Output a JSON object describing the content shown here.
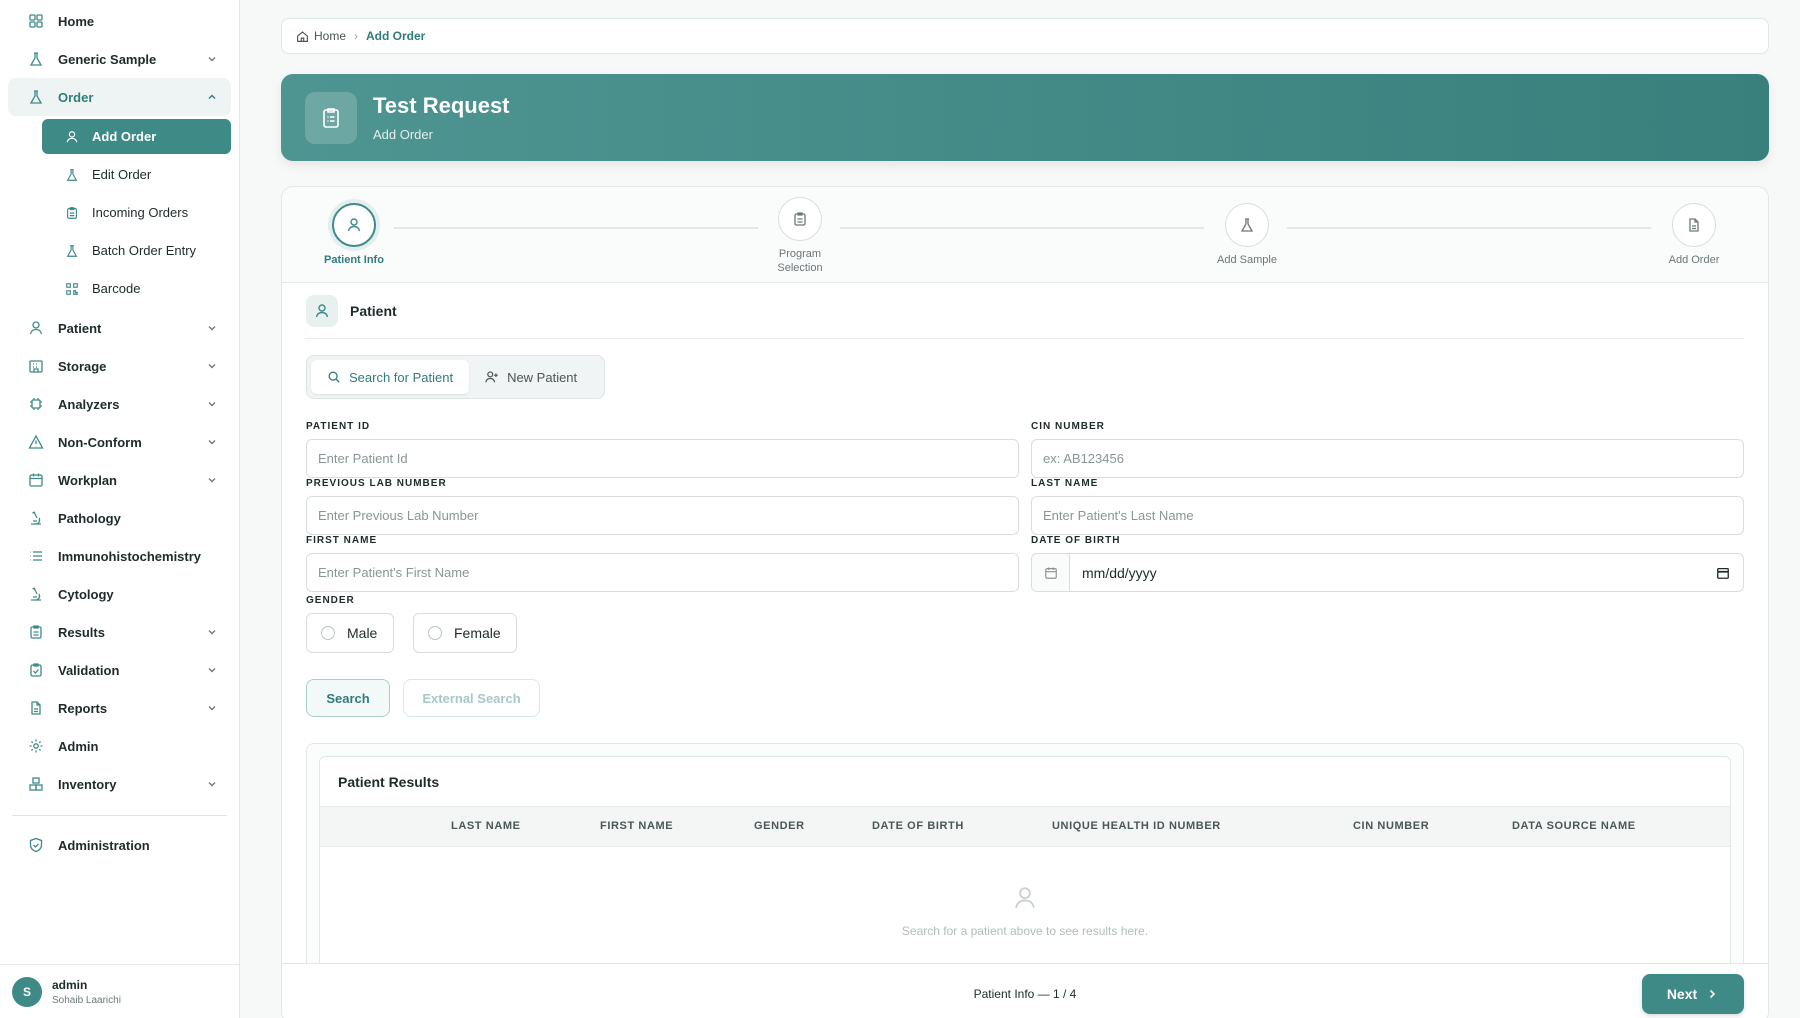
{
  "sidebar": {
    "items": [
      {
        "label": "Home",
        "icon": "grid-icon"
      },
      {
        "label": "Generic Sample",
        "icon": "flask-icon",
        "expandable": true
      },
      {
        "label": "Order",
        "icon": "flask-icon",
        "expandable": true,
        "open": true
      },
      {
        "label": "Patient",
        "icon": "user-icon",
        "expandable": true
      },
      {
        "label": "Storage",
        "icon": "building-icon",
        "expandable": true
      },
      {
        "label": "Analyzers",
        "icon": "chip-icon",
        "expandable": true
      },
      {
        "label": "Non-Conform",
        "icon": "warning-icon",
        "expandable": true
      },
      {
        "label": "Workplan",
        "icon": "calendar-icon",
        "expandable": true
      },
      {
        "label": "Pathology",
        "icon": "microscope-icon"
      },
      {
        "label": "Immunohistochemistry",
        "icon": "list-icon"
      },
      {
        "label": "Cytology",
        "icon": "microscope-icon"
      },
      {
        "label": "Results",
        "icon": "clipboard-icon",
        "expandable": true
      },
      {
        "label": "Validation",
        "icon": "clipboard-check-icon",
        "expandable": true
      },
      {
        "label": "Reports",
        "icon": "document-icon",
        "expandable": true
      },
      {
        "label": "Admin",
        "icon": "gear-icon"
      },
      {
        "label": "Inventory",
        "icon": "boxes-icon",
        "expandable": true
      },
      {
        "label": "Administration",
        "icon": "shield-icon"
      }
    ],
    "order_sub": [
      {
        "label": "Add Order",
        "icon": "user-icon",
        "active": true
      },
      {
        "label": "Edit Order",
        "icon": "flask-icon"
      },
      {
        "label": "Incoming Orders",
        "icon": "clipboard-icon"
      },
      {
        "label": "Batch Order Entry",
        "icon": "flask-icon"
      },
      {
        "label": "Barcode",
        "icon": "qr-icon"
      }
    ],
    "user": {
      "initial": "S",
      "name": "admin",
      "full_name": "Sohaib Laarichi"
    }
  },
  "breadcrumb": {
    "home": "Home",
    "current": "Add Order"
  },
  "hero": {
    "title": "Test Request",
    "subtitle": "Add Order"
  },
  "steps": [
    {
      "label": "Patient Info",
      "icon": "user-icon",
      "active": true
    },
    {
      "label": "Program Selection",
      "icon": "clipboard-icon"
    },
    {
      "label": "Add Sample",
      "icon": "flask-icon"
    },
    {
      "label": "Add Order",
      "icon": "document-icon"
    }
  ],
  "patient_section": {
    "title": "Patient"
  },
  "tabs": {
    "search": "Search for Patient",
    "new": "New Patient"
  },
  "form": {
    "patient_id": {
      "label": "PATIENT ID",
      "placeholder": "Enter Patient Id"
    },
    "cin_number": {
      "label": "CIN NUMBER",
      "placeholder": "ex: AB123456"
    },
    "prev_lab": {
      "label": "PREVIOUS LAB NUMBER",
      "placeholder": "Enter Previous Lab Number"
    },
    "last_name": {
      "label": "LAST NAME",
      "placeholder": "Enter Patient's Last Name"
    },
    "first_name": {
      "label": "FIRST NAME",
      "placeholder": "Enter Patient's First Name"
    },
    "dob": {
      "label": "DATE OF BIRTH",
      "value": "mm/dd/yyyy"
    },
    "gender": {
      "label": "GENDER",
      "male": "Male",
      "female": "Female"
    }
  },
  "buttons": {
    "search": "Search",
    "external_search": "External Search",
    "next": "Next"
  },
  "results": {
    "title": "Patient Results",
    "columns": [
      "LAST NAME",
      "FIRST NAME",
      "GENDER",
      "DATE OF BIRTH",
      "UNIQUE HEALTH ID NUMBER",
      "CIN NUMBER",
      "DATA SOURCE NAME"
    ],
    "empty_text": "Search for a patient above to see results here."
  },
  "footer": {
    "progress": "Patient Info — 1 / 4"
  },
  "colors": {
    "accent": "#3d8a87",
    "accent_light": "#e8f1f0"
  }
}
